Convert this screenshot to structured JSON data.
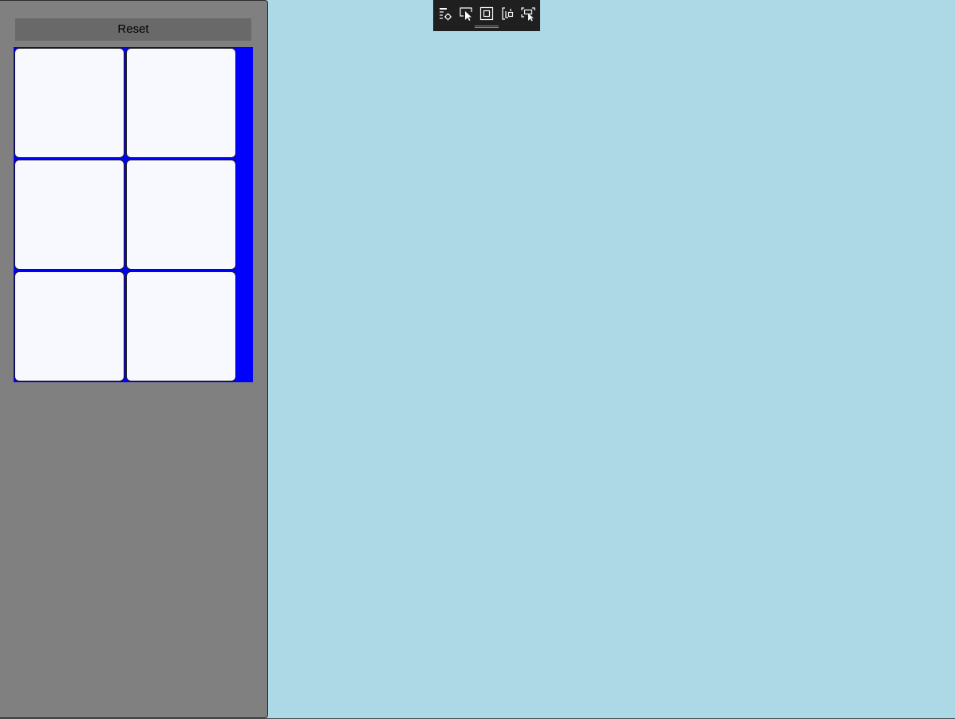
{
  "panel": {
    "reset_label": "Reset"
  },
  "tiles": [
    {
      "label": ""
    },
    {
      "label": ""
    },
    {
      "label": ""
    },
    {
      "label": ""
    },
    {
      "label": ""
    },
    {
      "label": ""
    }
  ],
  "toolbar": {
    "icons": [
      "live-visual-tree-icon",
      "select-element-icon",
      "display-layout-adorners-icon",
      "track-focus-icon",
      "preview-selection-icon"
    ]
  },
  "colors": {
    "canvas_background": "#add8e6",
    "panel_background": "#808080",
    "button_background": "#696969",
    "tile_container_background": "#0000ff",
    "tile_background": "#f8f8ff",
    "toolbar_background": "#1f1f1f"
  }
}
